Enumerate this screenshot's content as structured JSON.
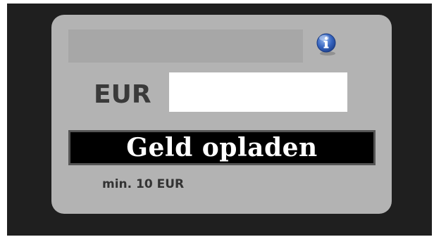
{
  "widget": {
    "currency_label": "EUR",
    "amount_value": "",
    "topup_button_label": "Geld opladen",
    "min_note": "min. 10 EUR",
    "info_icon": "info-icon"
  },
  "colors": {
    "background": "#1f1f1f",
    "card": "#b3b3b3",
    "top_bar": "#a7a7a7",
    "button": "#000000",
    "button_text": "#ffffff",
    "info_icon": "#2e5fb8"
  }
}
